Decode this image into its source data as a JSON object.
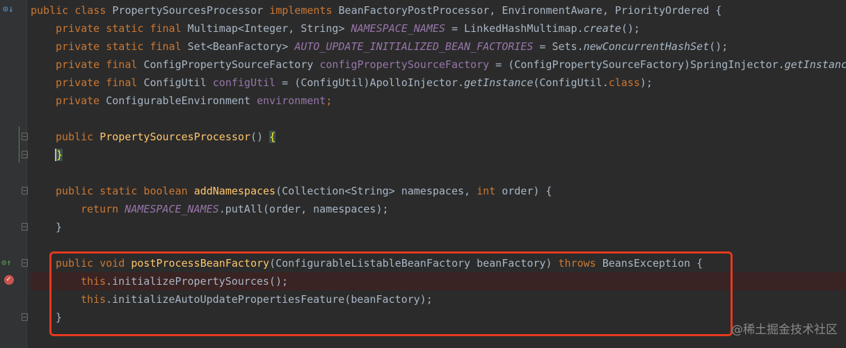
{
  "code": {
    "l1": {
      "kw1": "public class ",
      "name": "PropertySourcesProcessor ",
      "kw2": "implements ",
      "rest": "BeanFactoryPostProcessor, EnvironmentAware, PriorityOrdered {"
    },
    "l2": {
      "kw": "private static final ",
      "type": "Multimap<Integer, String> ",
      "field": "NAMESPACE_NAMES",
      "eq": " = LinkedHashMultimap.",
      "call": "create",
      "end": "();"
    },
    "l3": {
      "kw": "private static final ",
      "type": "Set<BeanFactory> ",
      "field": "AUTO_UPDATE_INITIALIZED_BEAN_FACTORIES",
      "eq": " = Sets.",
      "call": "newConcurrentHashSet",
      "end": "();"
    },
    "l4": {
      "kw": "private final ",
      "type": "ConfigPropertySourceFactory ",
      "field": "configPropertySourceFactory",
      "eq": " = (ConfigPropertySourceFactory)SpringInjector.",
      "call": "getInstance"
    },
    "l5": {
      "kw": "private final ",
      "type": "ConfigUtil ",
      "field": "configUtil",
      "eq": " = (ConfigUtil)ApolloInjector.",
      "call": "getInstance",
      "arg": "(ConfigUtil.",
      "cls": "class",
      "end": ");"
    },
    "l6": {
      "kw": "private ",
      "type": "ConfigurableEnvironment ",
      "field": "environment",
      "end": ";"
    },
    "l8": {
      "kw": "public ",
      "meth": "PropertySourcesProcessor",
      "paren": "() ",
      "brace": "{"
    },
    "l9": {
      "brace": "}"
    },
    "l11": {
      "kw": "public static boolean ",
      "meth": "addNamespaces",
      "p1": "(Collection<String> namespaces, ",
      "kw2": "int ",
      "p2": "order) {"
    },
    "l12": {
      "kw": "return ",
      "field": "NAMESPACE_NAMES",
      "rest": ".putAll(order, namespaces);"
    },
    "l13": {
      "brace": "}"
    },
    "l15": {
      "kw": "public void ",
      "meth": "postProcessBeanFactory",
      "p1": "(ConfigurableListableBeanFactory beanFactory) ",
      "kw2": "throws ",
      "p2": "BeansException {"
    },
    "l16": {
      "kw": "this",
      "rest": ".initializePropertySources();"
    },
    "l17": {
      "kw": "this",
      "rest": ".initializeAutoUpdatePropertiesFeature(beanFactory);"
    },
    "l18": {
      "brace": "}"
    }
  },
  "gutter": {
    "icons": [
      "override-down-icon",
      "implements-up-icon",
      "breakpoint-icon"
    ]
  },
  "watermark": "@稀土掘金技术社区"
}
